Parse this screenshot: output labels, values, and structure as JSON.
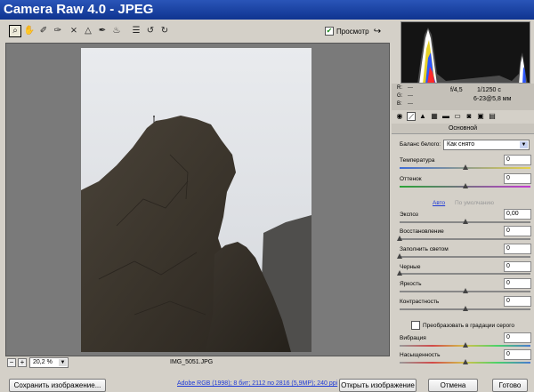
{
  "window": {
    "title": "Camera Raw 4.0  -  JPEG"
  },
  "toolbar": {
    "tools": [
      {
        "name": "zoom-tool",
        "glyph": "⌕"
      },
      {
        "name": "hand-tool",
        "glyph": "✋"
      },
      {
        "name": "white-balance-tool",
        "glyph": "✐"
      },
      {
        "name": "color-sampler-tool",
        "glyph": "✑"
      },
      {
        "name": "crop-tool",
        "glyph": "⨯"
      },
      {
        "name": "straighten-tool",
        "glyph": "△"
      },
      {
        "name": "retouch-tool",
        "glyph": "✒"
      },
      {
        "name": "red-eye-tool",
        "glyph": "♨"
      },
      {
        "name": "preferences-tool",
        "glyph": "☰"
      },
      {
        "name": "rotate-left-tool",
        "glyph": "↺"
      },
      {
        "name": "rotate-right-tool",
        "glyph": "↻"
      }
    ],
    "preview_checked": true,
    "preview_label": "Просмотр",
    "fullscreen_glyph": "↪"
  },
  "canvas": {
    "zoom_value": "20,2 %",
    "zoom_out_glyph": "−",
    "zoom_in_glyph": "+",
    "filename": "IMG_5051.JPG"
  },
  "exif": {
    "r_label": "R:",
    "g_label": "G:",
    "b_label": "B:",
    "r_value": "---",
    "g_value": "---",
    "b_value": "---",
    "aperture": "f/4,5",
    "shutter": "1/1250 с",
    "iso_lens": "6-23@5,8 мм"
  },
  "panel": {
    "tab_title": "Основной",
    "white_balance_label": "Баланс белого:",
    "white_balance_value": "Как снято",
    "temperature_label": "Температура",
    "temperature_value": "0",
    "tint_label": "Оттенок",
    "tint_value": "0",
    "auto_link": "Авто",
    "default_link": "По умолчанию",
    "exposure_label": "Экспоз",
    "exposure_value": "0,00",
    "recovery_label": "Восстановление",
    "recovery_value": "0",
    "fill_light_label": "Заполнить светом",
    "fill_light_value": "0",
    "blacks_label": "Черные",
    "blacks_value": "0",
    "brightness_label": "Яркость",
    "brightness_value": "0",
    "contrast_label": "Контрастность",
    "contrast_value": "0",
    "grayscale_label": "Преобразовать в градации серого",
    "vibrance_label": "Вибрация",
    "vibrance_value": "0",
    "saturation_label": "Насыщенность",
    "saturation_value": "0"
  },
  "footer": {
    "save_label": "Сохранить изображение...",
    "workflow_info": "Adobe RGB (1998); 8 бит; 2112 по 2816 (5,9МР); 240 ppi",
    "open_label": "Открыть изображение",
    "cancel_label": "Отмена",
    "done_label": "Готово"
  },
  "colors": {
    "title_bar": "#1a45a8",
    "canvas_bg": "#7a7a7a",
    "panel_bg": "#d4d0c8",
    "link": "#1e3ad7"
  }
}
